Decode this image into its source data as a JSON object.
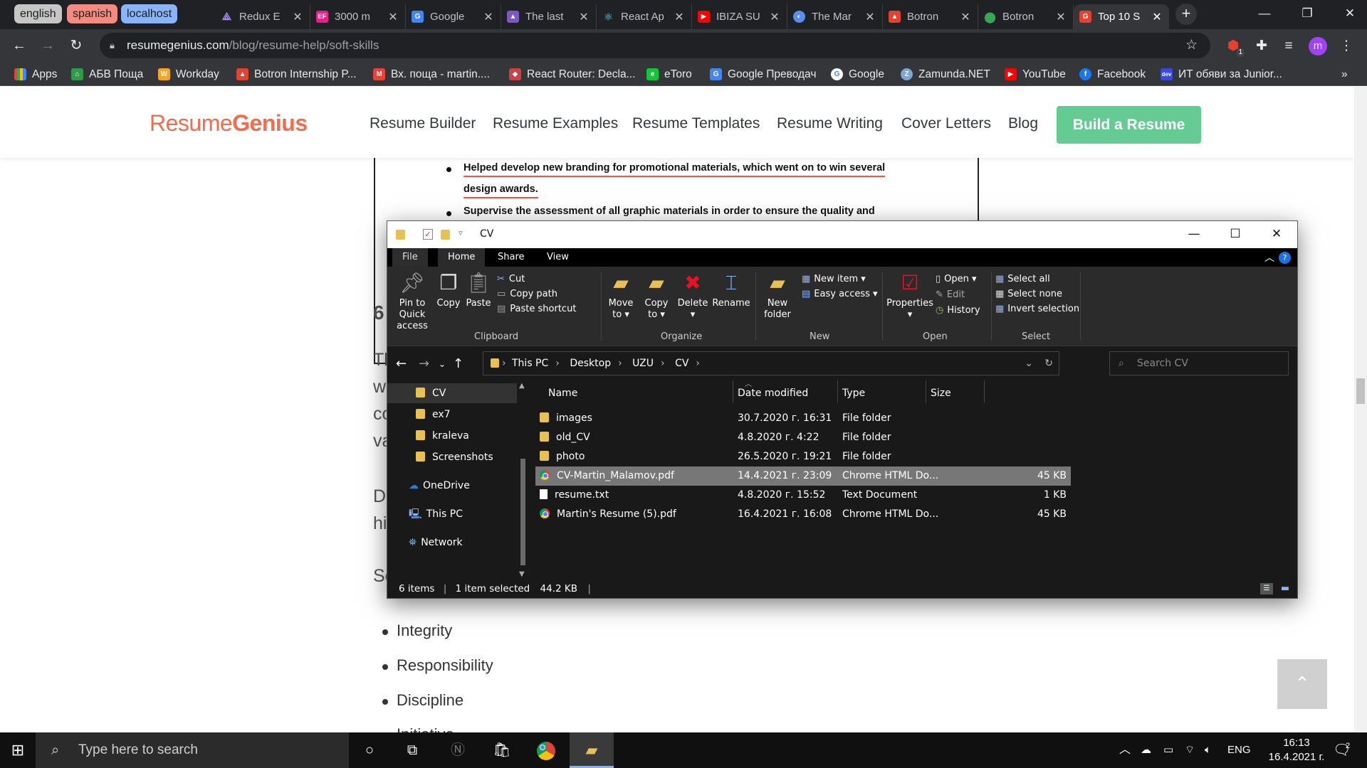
{
  "browser": {
    "pinned_tabs": [
      "english",
      "spanish",
      "localhost"
    ],
    "tabs": [
      {
        "title": "Redux E",
        "icon": "redux-icon"
      },
      {
        "title": "3000 m",
        "icon": "ef-icon"
      },
      {
        "title": "Google",
        "icon": "google-translate-icon"
      },
      {
        "title": "The last",
        "icon": "purple-icon"
      },
      {
        "title": "React Ap",
        "icon": "react-icon"
      },
      {
        "title": "IBIZA SU",
        "icon": "youtube-icon"
      },
      {
        "title": "The Mar",
        "icon": "globe-icon"
      },
      {
        "title": "Botron",
        "icon": "botron-icon"
      },
      {
        "title": "Botron",
        "icon": "maps-icon"
      },
      {
        "title": "Top 10 S",
        "icon": "g-icon",
        "active": true
      }
    ],
    "url_host": "resumegenius.com",
    "url_path": "/blog/resume-help/soft-skills",
    "profile_initial": "m",
    "extension_badge": "1",
    "bookmarks": [
      "Apps",
      "АБВ Поща",
      "Workday",
      "Botron Internship P...",
      "Вх. поща - martin....",
      "React Router: Decla...",
      "eToro",
      "Google Преводач",
      "Google",
      "Zamunda.NET",
      "YouTube",
      "Facebook",
      "ИТ обяви за Junior..."
    ],
    "bookmarks_more": "»"
  },
  "site": {
    "logo_light": "Resume",
    "logo_bold": "Genius",
    "nav": [
      "Resume Builder",
      "Resume Examples",
      "Resume Templates",
      "Resume Writing",
      "Cover Letters",
      "Blog"
    ],
    "cta": "Build a Resume",
    "resume_line1": "Helped develop new branding for promotional materials, which went on to win several",
    "resume_line2": "design awards.",
    "resume_line3": "Supervise the assessment of all graphic materials in order to ensure the quality and",
    "partial_text": [
      "6",
      "Th",
      "w",
      "co",
      "va",
      "De",
      "hi",
      "So"
    ],
    "list": [
      "Integrity",
      "Responsibility",
      "Discipline",
      "Initiative"
    ],
    "back_to_top": "⌃"
  },
  "explorer": {
    "title": "CV",
    "ribbon_tabs": [
      "File",
      "Home",
      "Share",
      "View"
    ],
    "clipboard": {
      "pin": "Pin to Quick access",
      "copy": "Copy",
      "paste": "Paste",
      "cut": "Cut",
      "copy_path": "Copy path",
      "paste_shortcut": "Paste shortcut",
      "group": "Clipboard"
    },
    "organize": {
      "move": "Move to",
      "copy": "Copy to",
      "delete": "Delete",
      "rename": "Rename",
      "group": "Organize"
    },
    "new": {
      "folder": "New folder",
      "item": "New item",
      "easy": "Easy access",
      "group": "New"
    },
    "open": {
      "properties": "Properties",
      "open": "Open",
      "edit": "Edit",
      "history": "History",
      "group": "Open"
    },
    "select": {
      "all": "Select all",
      "none": "Select none",
      "invert": "Invert selection",
      "group": "Select"
    },
    "breadcrumb": [
      "This PC",
      "Desktop",
      "UZU",
      "CV"
    ],
    "search_placeholder": "Search CV",
    "nav_items": [
      "CV",
      "ex7",
      "kraleva",
      "Screenshots",
      "OneDrive",
      "This PC",
      "Network"
    ],
    "columns": [
      "Name",
      "Date modified",
      "Type",
      "Size"
    ],
    "files": [
      {
        "name": "images",
        "date": "30.7.2020 г. 16:31",
        "type": "File folder",
        "size": "",
        "kind": "folder"
      },
      {
        "name": "old_CV",
        "date": "4.8.2020 г. 4:22",
        "type": "File folder",
        "size": "",
        "kind": "folder"
      },
      {
        "name": "photo",
        "date": "26.5.2020 г. 19:21",
        "type": "File folder",
        "size": "",
        "kind": "folder"
      },
      {
        "name": "CV-Martin_Malamov.pdf",
        "date": "14.4.2021 г. 23:09",
        "type": "Chrome HTML Do...",
        "size": "45 KB",
        "kind": "chrome",
        "selected": true
      },
      {
        "name": "resume.txt",
        "date": "4.8.2020 г. 15:52",
        "type": "Text Document",
        "size": "1 KB",
        "kind": "txt"
      },
      {
        "name": "Martin's Resume (5).pdf",
        "date": "16.4.2021 г. 16:08",
        "type": "Chrome HTML Do...",
        "size": "45 KB",
        "kind": "chrome"
      }
    ],
    "status": {
      "items": "6 items",
      "selected": "1 item selected",
      "size": "44.2 KB"
    }
  },
  "taskbar": {
    "search_placeholder": "Type here to search",
    "lang": "ENG",
    "time": "16:13",
    "date": "16.4.2021 г.",
    "notifications": "2"
  }
}
